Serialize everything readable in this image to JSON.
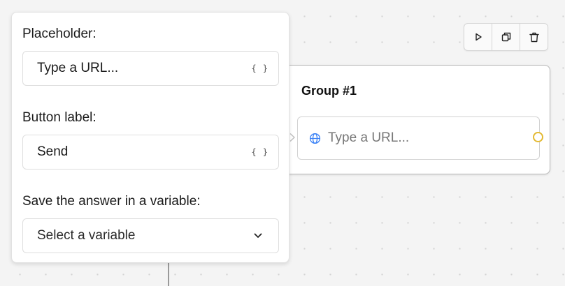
{
  "popover": {
    "placeholder_label": "Placeholder:",
    "placeholder_value": "Type a URL...",
    "button_label_label": "Button label:",
    "button_label_value": "Send",
    "variable_label": "Save the answer in a variable:",
    "variable_select_value": "Select a variable",
    "braces_glyph": "{ }"
  },
  "toolbar": {
    "icons": [
      "play-icon",
      "duplicate-icon",
      "trash-icon"
    ]
  },
  "group": {
    "title": "Group #1",
    "block_text": "Type a URL...",
    "block_icon": "globe-icon"
  },
  "colors": {
    "accent_blue": "#3b82f6",
    "port_yellow": "#e3b931",
    "canvas": "#f4f4f4"
  }
}
